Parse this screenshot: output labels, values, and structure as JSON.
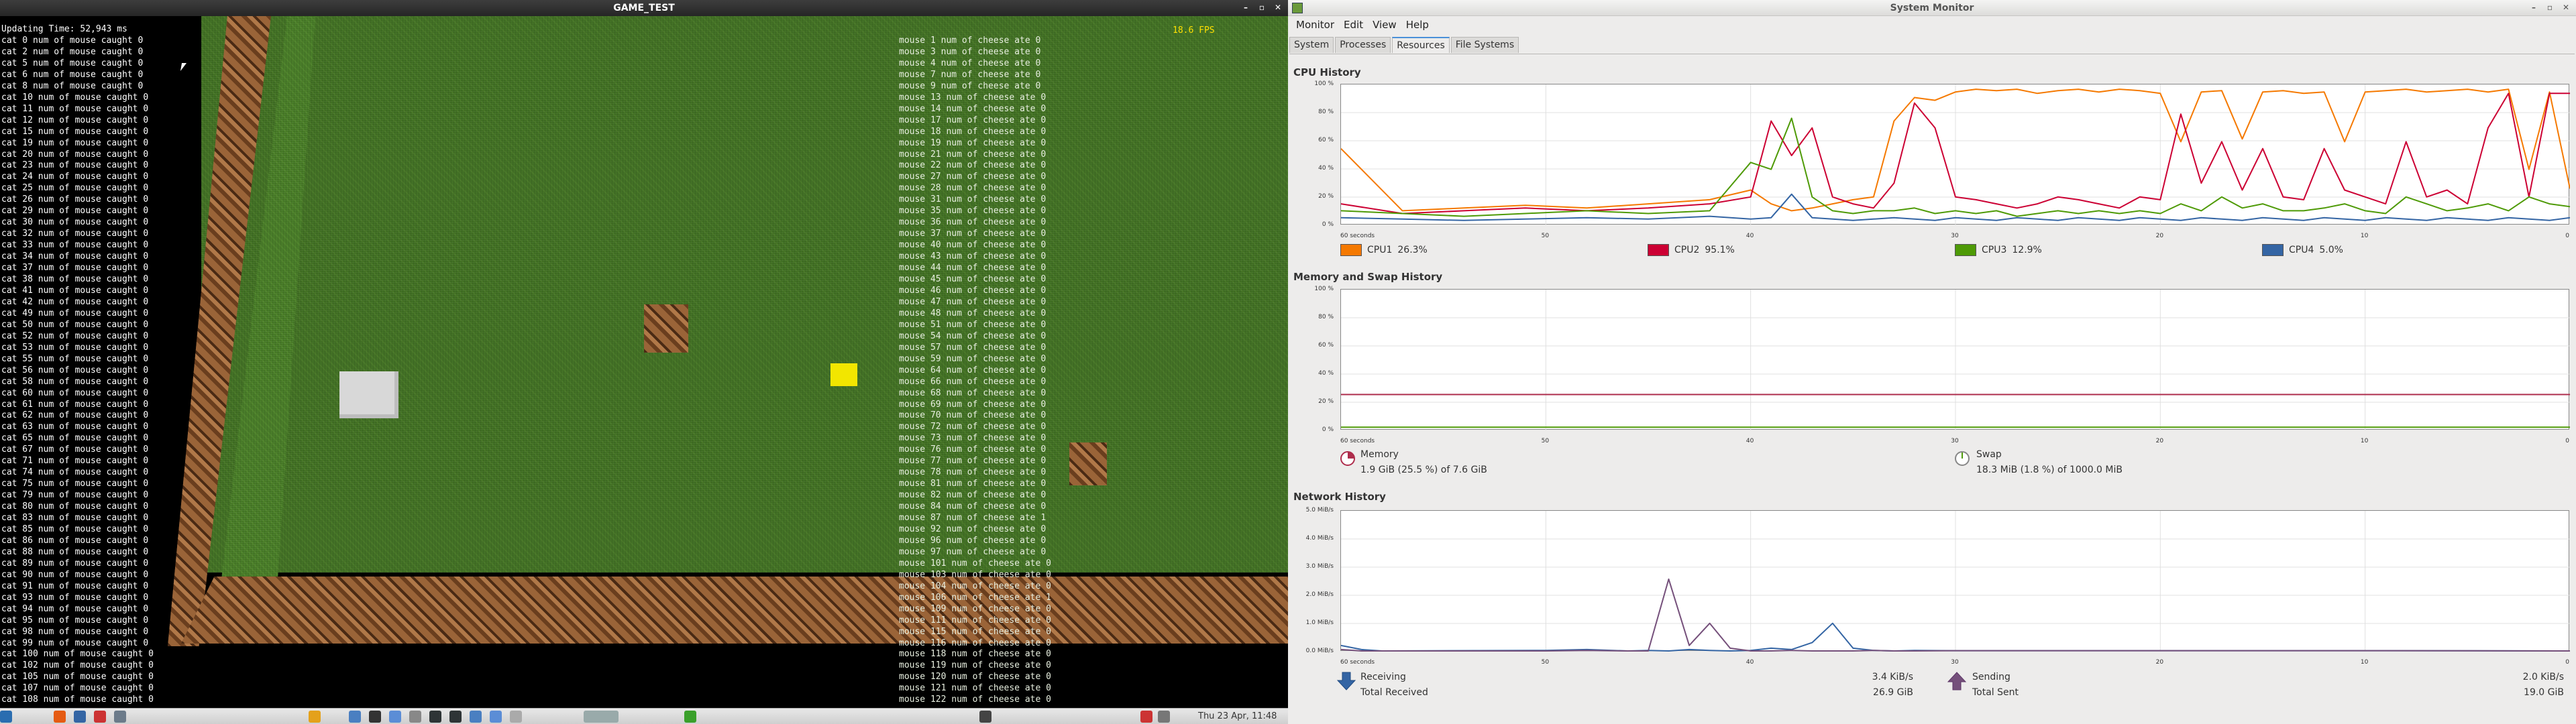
{
  "game": {
    "title": "GAME_TEST",
    "fps": "18.6 FPS",
    "update_time": "Updating Time: 52,943 ms",
    "cats": [
      "cat 0 num of mouse caught 0",
      "cat 2 num of mouse caught 0",
      "cat 5 num of mouse caught 0",
      "cat 6 num of mouse caught 0",
      "cat 8 num of mouse caught 0",
      "cat 10 num of mouse caught 0",
      "cat 11 num of mouse caught 0",
      "cat 12 num of mouse caught 0",
      "cat 15 num of mouse caught 0",
      "cat 19 num of mouse caught 0",
      "cat 20 num of mouse caught 0",
      "cat 23 num of mouse caught 0",
      "cat 24 num of mouse caught 0",
      "cat 25 num of mouse caught 0",
      "cat 26 num of mouse caught 0",
      "cat 29 num of mouse caught 0",
      "cat 30 num of mouse caught 0",
      "cat 32 num of mouse caught 0",
      "cat 33 num of mouse caught 0",
      "cat 34 num of mouse caught 0",
      "cat 37 num of mouse caught 0",
      "cat 38 num of mouse caught 0",
      "cat 41 num of mouse caught 0",
      "cat 42 num of mouse caught 0",
      "cat 49 num of mouse caught 0",
      "cat 50 num of mouse caught 0",
      "cat 52 num of mouse caught 0",
      "cat 53 num of mouse caught 0",
      "cat 55 num of mouse caught 0",
      "cat 56 num of mouse caught 0",
      "cat 58 num of mouse caught 0",
      "cat 60 num of mouse caught 0",
      "cat 61 num of mouse caught 0",
      "cat 62 num of mouse caught 0",
      "cat 63 num of mouse caught 0",
      "cat 65 num of mouse caught 0",
      "cat 67 num of mouse caught 0",
      "cat 71 num of mouse caught 0",
      "cat 74 num of mouse caught 0",
      "cat 75 num of mouse caught 0",
      "cat 79 num of mouse caught 0",
      "cat 80 num of mouse caught 0",
      "cat 83 num of mouse caught 0",
      "cat 85 num of mouse caught 0",
      "cat 86 num of mouse caught 0",
      "cat 88 num of mouse caught 0",
      "cat 89 num of mouse caught 0",
      "cat 90 num of mouse caught 0",
      "cat 91 num of mouse caught 0",
      "cat 93 num of mouse caught 0",
      "cat 94 num of mouse caught 0",
      "cat 95 num of mouse caught 0",
      "cat 98 num of mouse caught 0",
      "cat 99 num of mouse caught 0",
      "cat 100 num of mouse caught 0",
      "cat 102 num of mouse caught 0",
      "cat 105 num of mouse caught 0",
      "cat 107 num of mouse caught 0",
      "cat 108 num of mouse caught 0"
    ],
    "mice": [
      "mouse 1 num of cheese ate 0",
      "mouse 3 num of cheese ate 0",
      "mouse 4 num of cheese ate 0",
      "mouse 7 num of cheese ate 0",
      "mouse 9 num of cheese ate 0",
      "mouse 13 num of cheese ate 0",
      "mouse 14 num of cheese ate 0",
      "mouse 17 num of cheese ate 0",
      "mouse 18 num of cheese ate 0",
      "mouse 19 num of cheese ate 0",
      "mouse 21 num of cheese ate 0",
      "mouse 22 num of cheese ate 0",
      "mouse 27 num of cheese ate 0",
      "mouse 28 num of cheese ate 0",
      "mouse 31 num of cheese ate 0",
      "mouse 35 num of cheese ate 0",
      "mouse 36 num of cheese ate 0",
      "mouse 37 num of cheese ate 0",
      "mouse 40 num of cheese ate 0",
      "mouse 43 num of cheese ate 0",
      "mouse 44 num of cheese ate 0",
      "mouse 45 num of cheese ate 0",
      "mouse 46 num of cheese ate 0",
      "mouse 47 num of cheese ate 0",
      "mouse 48 num of cheese ate 0",
      "mouse 51 num of cheese ate 0",
      "mouse 54 num of cheese ate 0",
      "mouse 57 num of cheese ate 0",
      "mouse 59 num of cheese ate 0",
      "mouse 64 num of cheese ate 0",
      "mouse 66 num of cheese ate 0",
      "mouse 68 num of cheese ate 0",
      "mouse 69 num of cheese ate 0",
      "mouse 70 num of cheese ate 0",
      "mouse 72 num of cheese ate 0",
      "mouse 73 num of cheese ate 0",
      "mouse 76 num of cheese ate 0",
      "mouse 77 num of cheese ate 0",
      "mouse 78 num of cheese ate 0",
      "mouse 81 num of cheese ate 0",
      "mouse 82 num of cheese ate 0",
      "mouse 84 num of cheese ate 0",
      "mouse 87 num of cheese ate 1",
      "mouse 92 num of cheese ate 0",
      "mouse 96 num of cheese ate 0",
      "mouse 97 num of cheese ate 0",
      "mouse 101 num of cheese ate 0",
      "mouse 103 num of cheese ate 0",
      "mouse 104 num of cheese ate 0",
      "mouse 106 num of cheese ate 1",
      "mouse 109 num of cheese ate 0",
      "mouse 111 num of cheese ate 0",
      "mouse 115 num of cheese ate 0",
      "mouse 116 num of cheese ate 0",
      "mouse 118 num of cheese ate 0",
      "mouse 119 num of cheese ate 0",
      "mouse 120 num of cheese ate 0",
      "mouse 121 num of cheese ate 0",
      "mouse 122 num of cheese ate 0"
    ],
    "colors": {
      "grass": "#3f6e22",
      "wood": "#7a4c2a",
      "cheese": "#f2e600",
      "cat_cube": "#d8d8d8",
      "fps": "#ffe000"
    }
  },
  "taskbar": {
    "clock": "Thu 23 Apr, 11:48",
    "icons": [
      "app-menu-icon",
      "firefox-icon",
      "network-icon",
      "paint-icon",
      "settings-icon",
      "chrome-icon",
      "files-icon",
      "terminal-icon",
      "folder-icon",
      "editor-icon",
      "terminal2-icon",
      "terminal3-icon",
      "files2-icon",
      "folder2-icon",
      "window-icon",
      "monitor-preview-icon",
      "run-icon",
      "window2-icon",
      "tray-icon",
      "volume-icon"
    ]
  },
  "sysmon": {
    "title": "System Monitor",
    "menu": [
      "Monitor",
      "Edit",
      "View",
      "Help"
    ],
    "tabs": [
      "System",
      "Processes",
      "Resources",
      "File Systems"
    ],
    "active_tab": "Resources",
    "cpu": {
      "header": "CPU History",
      "y_ticks": [
        "100 %",
        "80 %",
        "60 %",
        "40 %",
        "20 %",
        "0 %"
      ],
      "x_ticks": [
        "60 seconds",
        "50",
        "40",
        "30",
        "20",
        "10",
        "0"
      ],
      "legend": [
        {
          "label": "CPU1",
          "value": "26.3%",
          "color": "#f57900"
        },
        {
          "label": "CPU2",
          "value": "95.1%",
          "color": "#cc0033"
        },
        {
          "label": "CPU3",
          "value": "12.9%",
          "color": "#4e9a06"
        },
        {
          "label": "CPU4",
          "value": "5.0%",
          "color": "#3465a4"
        }
      ]
    },
    "mem": {
      "header": "Memory and Swap History",
      "y_ticks": [
        "100 %",
        "80 %",
        "60 %",
        "40 %",
        "20 %",
        "0 %"
      ],
      "x_ticks": [
        "60 seconds",
        "50",
        "40",
        "30",
        "20",
        "10",
        "0"
      ],
      "memory_label": "Memory",
      "memory_value": "1.9 GiB (25.5 %) of 7.6 GiB",
      "swap_label": "Swap",
      "swap_value": "18.3 MiB (1.8 %) of 1000.0 MiB",
      "memory_color": "#ae2d4c",
      "swap_color": "#4e9a06"
    },
    "net": {
      "header": "Network History",
      "y_ticks": [
        "5.0 MiB/s",
        "4.0 MiB/s",
        "3.0 MiB/s",
        "2.0 MiB/s",
        "1.0 MiB/s",
        "0.0 MiB/s"
      ],
      "x_ticks": [
        "60 seconds",
        "50",
        "40",
        "30",
        "20",
        "10",
        "0"
      ],
      "receiving_label": "Receiving",
      "receiving_value": "3.4 KiB/s",
      "total_received_label": "Total Received",
      "total_received_value": "26.9 GiB",
      "sending_label": "Sending",
      "sending_value": "2.0 KiB/s",
      "total_sent_label": "Total Sent",
      "total_sent_value": "19.0 GiB",
      "receiving_color": "#3465a4",
      "sending_color": "#75507b"
    }
  },
  "chart_data": [
    {
      "type": "line",
      "title": "CPU History",
      "x": [
        60,
        57,
        54,
        51,
        48,
        45,
        42,
        40,
        39,
        38,
        37,
        36,
        35,
        34,
        33,
        32,
        31,
        30,
        29,
        28,
        27,
        26,
        25,
        24,
        23,
        22,
        21,
        20,
        19,
        18,
        17,
        16,
        15,
        14,
        13,
        12,
        11,
        10,
        9,
        8,
        7,
        6,
        5,
        4,
        3,
        2,
        1,
        0
      ],
      "ylim": [
        0,
        100
      ],
      "series": [
        {
          "name": "CPU1",
          "values": [
            55,
            10,
            12,
            14,
            12,
            15,
            18,
            25,
            15,
            10,
            12,
            15,
            18,
            20,
            75,
            92,
            90,
            96,
            98,
            97,
            98,
            95,
            97,
            98,
            96,
            98,
            97,
            95,
            60,
            96,
            97,
            62,
            96,
            97,
            95,
            96,
            60,
            96,
            97,
            98,
            96,
            97,
            98,
            96,
            98,
            40,
            96,
            26
          ]
        },
        {
          "name": "CPU2",
          "values": [
            15,
            8,
            10,
            12,
            10,
            12,
            15,
            20,
            75,
            50,
            70,
            20,
            15,
            12,
            30,
            88,
            70,
            20,
            18,
            15,
            12,
            15,
            20,
            18,
            15,
            12,
            20,
            18,
            80,
            30,
            60,
            25,
            55,
            20,
            18,
            55,
            25,
            20,
            15,
            60,
            20,
            25,
            15,
            70,
            95,
            20,
            95,
            95
          ]
        },
        {
          "name": "CPU3",
          "values": [
            10,
            8,
            6,
            8,
            10,
            8,
            10,
            45,
            40,
            77,
            20,
            10,
            8,
            10,
            10,
            12,
            8,
            10,
            8,
            10,
            6,
            8,
            10,
            8,
            10,
            8,
            10,
            8,
            15,
            10,
            20,
            12,
            15,
            10,
            10,
            12,
            15,
            10,
            8,
            20,
            15,
            10,
            12,
            15,
            10,
            20,
            15,
            13
          ]
        },
        {
          "name": "CPU4",
          "values": [
            5,
            4,
            3,
            4,
            5,
            4,
            6,
            4,
            5,
            22,
            5,
            4,
            3,
            4,
            5,
            4,
            3,
            5,
            4,
            3,
            5,
            4,
            3,
            5,
            4,
            3,
            5,
            4,
            3,
            5,
            4,
            3,
            5,
            4,
            3,
            5,
            4,
            3,
            5,
            4,
            3,
            5,
            4,
            3,
            5,
            4,
            3,
            5
          ]
        }
      ]
    },
    {
      "type": "line",
      "title": "Memory and Swap History",
      "x": [
        60,
        0
      ],
      "ylim": [
        0,
        100
      ],
      "series": [
        {
          "name": "Memory",
          "values": [
            25.5,
            25.5
          ]
        },
        {
          "name": "Swap",
          "values": [
            1.8,
            1.8
          ]
        }
      ]
    },
    {
      "type": "line",
      "title": "Network History",
      "x": [
        60,
        59,
        58,
        50,
        48,
        46,
        45,
        44,
        43,
        42,
        41,
        40,
        39,
        38,
        37,
        36,
        35,
        34,
        33,
        32,
        30,
        25,
        20,
        10,
        0
      ],
      "ylim": [
        0,
        5
      ],
      "series": [
        {
          "name": "Receiving",
          "values": [
            0.2,
            0.05,
            0.0,
            0.02,
            0.05,
            0.0,
            0.02,
            0.0,
            0.05,
            0.02,
            0.0,
            0.02,
            0.1,
            0.05,
            0.3,
            1.0,
            0.1,
            0.02,
            0.0,
            0.02,
            0.01,
            0.01,
            0.01,
            0.01,
            0.0
          ]
        },
        {
          "name": "Sending",
          "values": [
            0.05,
            0.0,
            0.0,
            0.0,
            0.02,
            0.0,
            0.0,
            2.6,
            0.2,
            1.0,
            0.1,
            0.0,
            0.0,
            0.02,
            0.0,
            0.0,
            0.0,
            0.02,
            0.0,
            0.0,
            0.01,
            0.01,
            0.01,
            0.01,
            0.0
          ]
        }
      ]
    }
  ]
}
